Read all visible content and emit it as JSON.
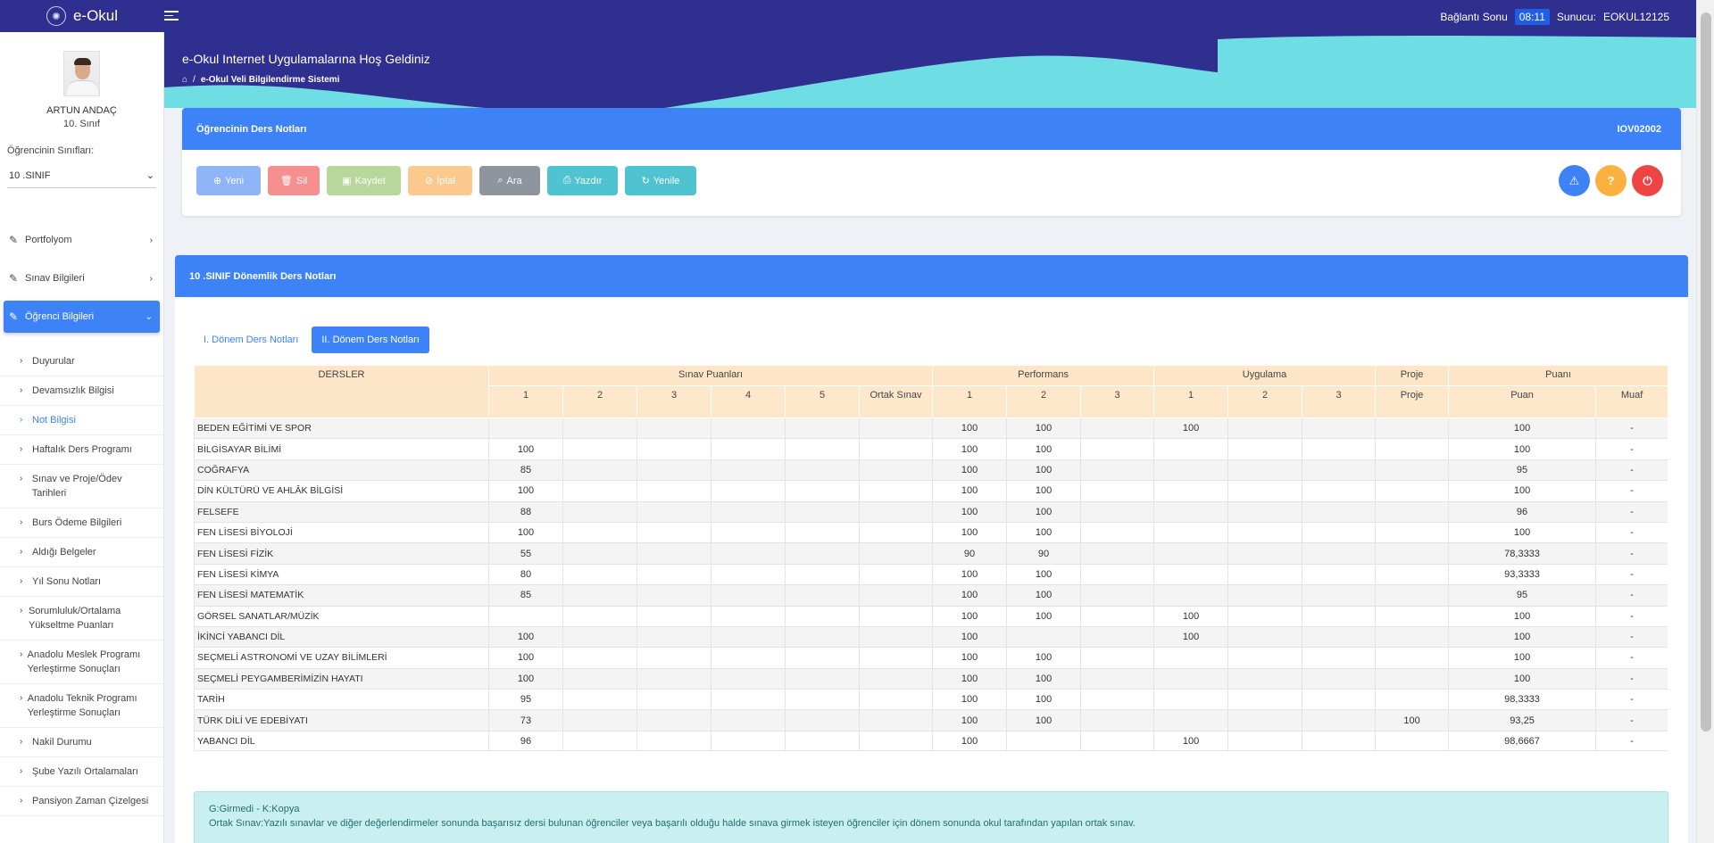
{
  "topbar": {
    "app_name": "e-Okul",
    "session_label": "Bağlantı Sonu",
    "session_time": "08:11",
    "server_label": "Sunucu:",
    "server_name": "EOKUL12125"
  },
  "banner": {
    "title": "e-Okul Internet Uygulamalarına Hoş Geldiniz",
    "breadcrumb_sep": "/",
    "breadcrumb": "e-Okul Veli Bilgilendirme Sistemi"
  },
  "sidebar": {
    "student_name": "ARTUN ANDAÇ",
    "student_grade": "10. Sınıf",
    "class_label": "Öğrencinin Sınıfları:",
    "class_value": "10 .SINIF",
    "nav": [
      {
        "label": "Portfolyom"
      },
      {
        "label": "Sınav Bilgileri"
      },
      {
        "label": "Öğrenci Bilgileri"
      }
    ],
    "subnav": [
      "Duyurular",
      "Devamsızlık Bilgisi",
      "Not Bilgisi",
      "Haftalık Ders Programı",
      "Sınav ve Proje/Ödev Tarihleri",
      "Burs Ödeme Bilgileri",
      "Aldığı Belgeler",
      "Yıl Sonu Notları",
      "Sorumluluk/Ortalama Yükseltme Puanları",
      "Anadolu Meslek Programı Yerleştirme Sonuçları",
      "Anadolu Teknik Programı Yerleştirme Sonuçları",
      "Nakil Durumu",
      "Şube Yazılı Ortalamaları",
      "Pansiyon Zaman Çizelgesi"
    ]
  },
  "card1": {
    "title": "Öğrencinin Ders Notları",
    "code": "IOV02002",
    "buttons": {
      "yeni": "Yeni",
      "sil": "Sil",
      "kaydet": "Kaydet",
      "iptal": "İptal",
      "ara": "Ara",
      "yazdir": "Yazdır",
      "yenile": "Yenile"
    }
  },
  "card2": {
    "title": "10 .SINIF Dönemlik Ders Notları",
    "tabs": [
      "I. Dönem Ders Notları",
      "II. Dönem Ders Notları"
    ]
  },
  "table": {
    "group_headers": {
      "dersler": "DERSLER",
      "sinav": "Sınav Puanları",
      "performans": "Performans",
      "uygulama": "Uygulama",
      "proje": "Proje",
      "puani": "Puanı"
    },
    "sub_headers": {
      "s1": "1",
      "s2": "2",
      "s3": "3",
      "s4": "4",
      "s5": "5",
      "ortak": "Ortak Sınav",
      "p1": "1",
      "p2": "2",
      "p3": "3",
      "u1": "1",
      "u2": "2",
      "u3": "3",
      "proje": "Proje",
      "puan": "Puan",
      "muaf": "Muaf"
    },
    "rows": [
      [
        "BEDEN EĞİTİMİ VE SPOR",
        "",
        "",
        "",
        "",
        "",
        "",
        "100",
        "100",
        "",
        "100",
        "",
        "",
        "",
        "100",
        "-"
      ],
      [
        "BİLGİSAYAR BİLİMİ",
        "100",
        "",
        "",
        "",
        "",
        "",
        "100",
        "100",
        "",
        "",
        "",
        "",
        "",
        "100",
        "-"
      ],
      [
        "COĞRAFYA",
        "85",
        "",
        "",
        "",
        "",
        "",
        "100",
        "100",
        "",
        "",
        "",
        "",
        "",
        "95",
        "-"
      ],
      [
        "DİN KÜLTÜRÜ VE AHLÂK BİLGİSİ",
        "100",
        "",
        "",
        "",
        "",
        "",
        "100",
        "100",
        "",
        "",
        "",
        "",
        "",
        "100",
        "-"
      ],
      [
        "FELSEFE",
        "88",
        "",
        "",
        "",
        "",
        "",
        "100",
        "100",
        "",
        "",
        "",
        "",
        "",
        "96",
        "-"
      ],
      [
        "FEN LİSESİ BİYOLOJİ",
        "100",
        "",
        "",
        "",
        "",
        "",
        "100",
        "100",
        "",
        "",
        "",
        "",
        "",
        "100",
        "-"
      ],
      [
        "FEN LİSESİ FİZİK",
        "55",
        "",
        "",
        "",
        "",
        "",
        "90",
        "90",
        "",
        "",
        "",
        "",
        "",
        "78,3333",
        "-"
      ],
      [
        "FEN LİSESİ KİMYA",
        "80",
        "",
        "",
        "",
        "",
        "",
        "100",
        "100",
        "",
        "",
        "",
        "",
        "",
        "93,3333",
        "-"
      ],
      [
        "FEN LİSESİ MATEMATİK",
        "85",
        "",
        "",
        "",
        "",
        "",
        "100",
        "100",
        "",
        "",
        "",
        "",
        "",
        "95",
        "-"
      ],
      [
        "GÖRSEL SANATLAR/MÜZİK",
        "",
        "",
        "",
        "",
        "",
        "",
        "100",
        "100",
        "",
        "100",
        "",
        "",
        "",
        "100",
        "-"
      ],
      [
        "İKİNCİ YABANCI DİL",
        "100",
        "",
        "",
        "",
        "",
        "",
        "100",
        "",
        "",
        "100",
        "",
        "",
        "",
        "100",
        "-"
      ],
      [
        "SEÇMELİ ASTRONOMİ VE UZAY BİLİMLERİ",
        "100",
        "",
        "",
        "",
        "",
        "",
        "100",
        "100",
        "",
        "",
        "",
        "",
        "",
        "100",
        "-"
      ],
      [
        "SEÇMELİ PEYGAMBERİMİZİN HAYATI",
        "100",
        "",
        "",
        "",
        "",
        "",
        "100",
        "100",
        "",
        "",
        "",
        "",
        "",
        "100",
        "-"
      ],
      [
        "TARİH",
        "95",
        "",
        "",
        "",
        "",
        "",
        "100",
        "100",
        "",
        "",
        "",
        "",
        "",
        "98,3333",
        "-"
      ],
      [
        "TÜRK DİLİ VE EDEBİYATI",
        "73",
        "",
        "",
        "",
        "",
        "",
        "100",
        "100",
        "",
        "",
        "",
        "",
        "100",
        "93,25",
        "-"
      ],
      [
        "YABANCI DİL",
        "96",
        "",
        "",
        "",
        "",
        "",
        "100",
        "",
        "",
        "100",
        "",
        "",
        "",
        "98,6667",
        "-"
      ],
      [
        "",
        "",
        "",
        "",
        "",
        "",
        "",
        "",
        "",
        "",
        "",
        "",
        "",
        "",
        "",
        ""
      ]
    ]
  },
  "info": {
    "line1": "G:Girmedi - K:Kopya",
    "line2": "Ortak Sınav:Yazılı sınavlar ve diğer değerlendirmeler sonunda başarısız dersi bulunan öğrenciler veya başarılı olduğu halde sınava girmek isteyen öğrenciler için dönem sonunda okul tarafından yapılan ortak sınav."
  },
  "colors": {
    "header_dark": "#2f2f8f",
    "wave_cyan": "#6fdde4",
    "primary": "#3d82f6",
    "table_header": "#fde6c8"
  }
}
